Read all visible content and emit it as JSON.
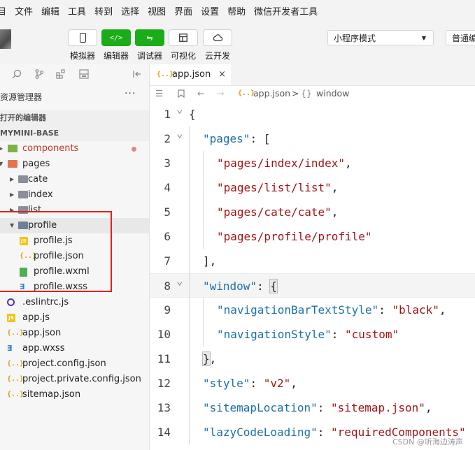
{
  "menu": [
    "目",
    "文件",
    "编辑",
    "工具",
    "转到",
    "选择",
    "视图",
    "界面",
    "设置",
    "帮助",
    "微信开发者工具"
  ],
  "toolbar": {
    "buttons": [
      {
        "label": "模拟器",
        "icon": "phone-icon"
      },
      {
        "label": "编辑器",
        "icon": "code-icon"
      },
      {
        "label": "调试器",
        "icon": "debug-icon"
      },
      {
        "label": "可视化",
        "icon": "layout-icon"
      },
      {
        "label": "云开发",
        "icon": "cloud-icon"
      }
    ],
    "mode_select": "小程序模式",
    "compile_select": "普通编"
  },
  "sidebar": {
    "explorer_title": "资源管理器",
    "more": "···",
    "open_editors": "打开的编辑器",
    "project": "MYMINI-BASE",
    "tree": [
      {
        "name": "components",
        "type": "folder",
        "color": "#c0392b",
        "depth": 0,
        "open": false
      },
      {
        "name": "pages",
        "type": "folder",
        "depth": 0,
        "open": true
      },
      {
        "name": "cate",
        "type": "folder",
        "depth": 1,
        "open": false
      },
      {
        "name": "index",
        "type": "folder",
        "depth": 1,
        "open": false
      },
      {
        "name": "list",
        "type": "folder",
        "depth": 1,
        "open": false
      },
      {
        "name": "profile",
        "type": "folder",
        "depth": 1,
        "open": true
      },
      {
        "name": "profile.js",
        "type": "js",
        "depth": 2
      },
      {
        "name": "profile.json",
        "type": "json",
        "depth": 2
      },
      {
        "name": "profile.wxml",
        "type": "wxml",
        "depth": 2
      },
      {
        "name": "profile.wxss",
        "type": "wxss",
        "depth": 2
      },
      {
        "name": ".eslintrc.js",
        "type": "eslint",
        "depth": 0
      },
      {
        "name": "app.js",
        "type": "js",
        "depth": 0
      },
      {
        "name": "app.json",
        "type": "json",
        "depth": 0
      },
      {
        "name": "app.wxss",
        "type": "wxss",
        "depth": 0
      },
      {
        "name": "project.config.json",
        "type": "json",
        "depth": 0
      },
      {
        "name": "project.private.config.json",
        "type": "json",
        "depth": 0
      },
      {
        "name": "sitemap.json",
        "type": "json",
        "depth": 0
      }
    ]
  },
  "editor": {
    "tab": {
      "icon": "{..}",
      "name": "app.json",
      "close": "×"
    },
    "breadcrumb": {
      "file": "app.json",
      "sep": ">",
      "node_icon": "{}",
      "node": "window"
    },
    "lines": [
      {
        "n": "1",
        "tokens": [
          {
            "t": "{",
            "c": "p"
          }
        ]
      },
      {
        "n": "2",
        "tokens": [
          {
            "t": "\"pages\"",
            "c": "k"
          },
          {
            "t": ": [",
            "c": "p"
          }
        ]
      },
      {
        "n": "3",
        "tokens": [
          {
            "t": "\"pages/index/index\"",
            "c": "s"
          },
          {
            "t": ",",
            "c": "p"
          }
        ]
      },
      {
        "n": "4",
        "tokens": [
          {
            "t": "\"pages/list/list\"",
            "c": "s"
          },
          {
            "t": ",",
            "c": "p"
          }
        ]
      },
      {
        "n": "5",
        "tokens": [
          {
            "t": "\"pages/cate/cate\"",
            "c": "s"
          },
          {
            "t": ",",
            "c": "p"
          }
        ]
      },
      {
        "n": "6",
        "tokens": [
          {
            "t": "\"pages/profile/profile\"",
            "c": "s"
          }
        ]
      },
      {
        "n": "7",
        "tokens": [
          {
            "t": "],",
            "c": "p"
          }
        ]
      },
      {
        "n": "8",
        "tokens": [
          {
            "t": "\"window\"",
            "c": "k"
          },
          {
            "t": ": ",
            "c": "p"
          },
          {
            "t": "{",
            "c": "p"
          }
        ]
      },
      {
        "n": "9",
        "tokens": [
          {
            "t": "\"navigationBarTextStyle\"",
            "c": "k"
          },
          {
            "t": ": ",
            "c": "p"
          },
          {
            "t": "\"black\"",
            "c": "s"
          },
          {
            "t": ",",
            "c": "p"
          }
        ]
      },
      {
        "n": "10",
        "tokens": [
          {
            "t": "\"navigationStyle\"",
            "c": "k"
          },
          {
            "t": ": ",
            "c": "p"
          },
          {
            "t": "\"custom\"",
            "c": "s"
          }
        ]
      },
      {
        "n": "11",
        "tokens": [
          {
            "t": "}",
            "c": "p"
          },
          {
            "t": ",",
            "c": "p"
          }
        ]
      },
      {
        "n": "12",
        "tokens": [
          {
            "t": "\"style\"",
            "c": "k"
          },
          {
            "t": ": ",
            "c": "p"
          },
          {
            "t": "\"v2\"",
            "c": "s"
          },
          {
            "t": ",",
            "c": "p"
          }
        ]
      },
      {
        "n": "13",
        "tokens": [
          {
            "t": "\"sitemapLocation\"",
            "c": "k"
          },
          {
            "t": ": ",
            "c": "p"
          },
          {
            "t": "\"sitemap.json\"",
            "c": "s"
          },
          {
            "t": ",",
            "c": "p"
          }
        ]
      },
      {
        "n": "14",
        "tokens": [
          {
            "t": "\"lazyCodeLoading\"",
            "c": "k"
          },
          {
            "t": ": ",
            "c": "p"
          },
          {
            "t": "\"requiredComponents\"",
            "c": "s"
          }
        ]
      }
    ]
  },
  "watermark": "CSDN @听海边涛声",
  "colors": {
    "green": "#1aad19",
    "highlight_box": "#e02020",
    "key": "#1e6fa8",
    "string": "#a31515"
  }
}
